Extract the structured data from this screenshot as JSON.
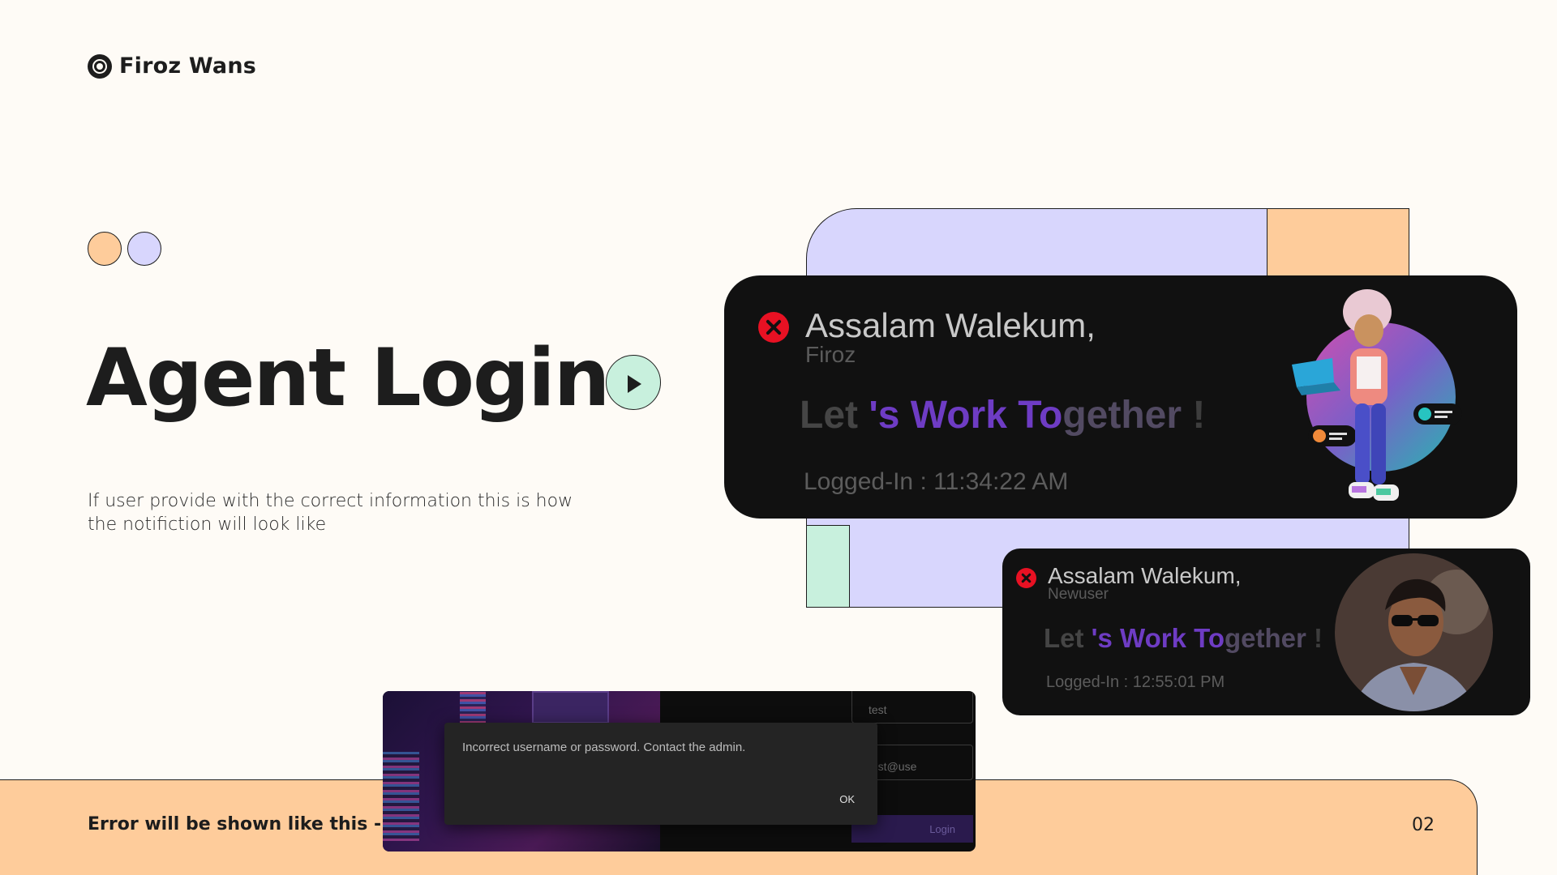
{
  "brand": {
    "name": "Firoz Wans",
    "icon": "target-icon"
  },
  "title": "Agent Login",
  "description": "If user provide with the correct information this is how the notifiction will look like",
  "colors": {
    "peach": "#fecc9b",
    "lavender": "#d8d6fd",
    "mint": "#c8f0dd",
    "background": "#fefbf6",
    "purple": "#6e3cc4"
  },
  "notifications": [
    {
      "greeting": "Assalam Walekum,",
      "username": "Firoz",
      "tagline": {
        "a": "Let ",
        "b": "'s Work To",
        "c": "gether",
        "d": " !"
      },
      "logged_in": "Logged-In : 11:34:22 AM",
      "avatar": "3d-character-with-laptop"
    },
    {
      "greeting": "Assalam Walekum,",
      "username": "Newuser",
      "tagline": {
        "a": "Let ",
        "b": "'s Work To",
        "c": "gether",
        "d": " !"
      },
      "logged_in": "Logged-In : 12:55:01 PM",
      "avatar": "user-photo"
    }
  ],
  "error_preview": {
    "message": "Incorrect username or password. Contact the admin.",
    "ok_label": "OK",
    "username_value": "test",
    "password_value": "test@use",
    "login_label": "Login"
  },
  "footer": {
    "label": "Error will be shown like this - >",
    "page_number": "02"
  }
}
